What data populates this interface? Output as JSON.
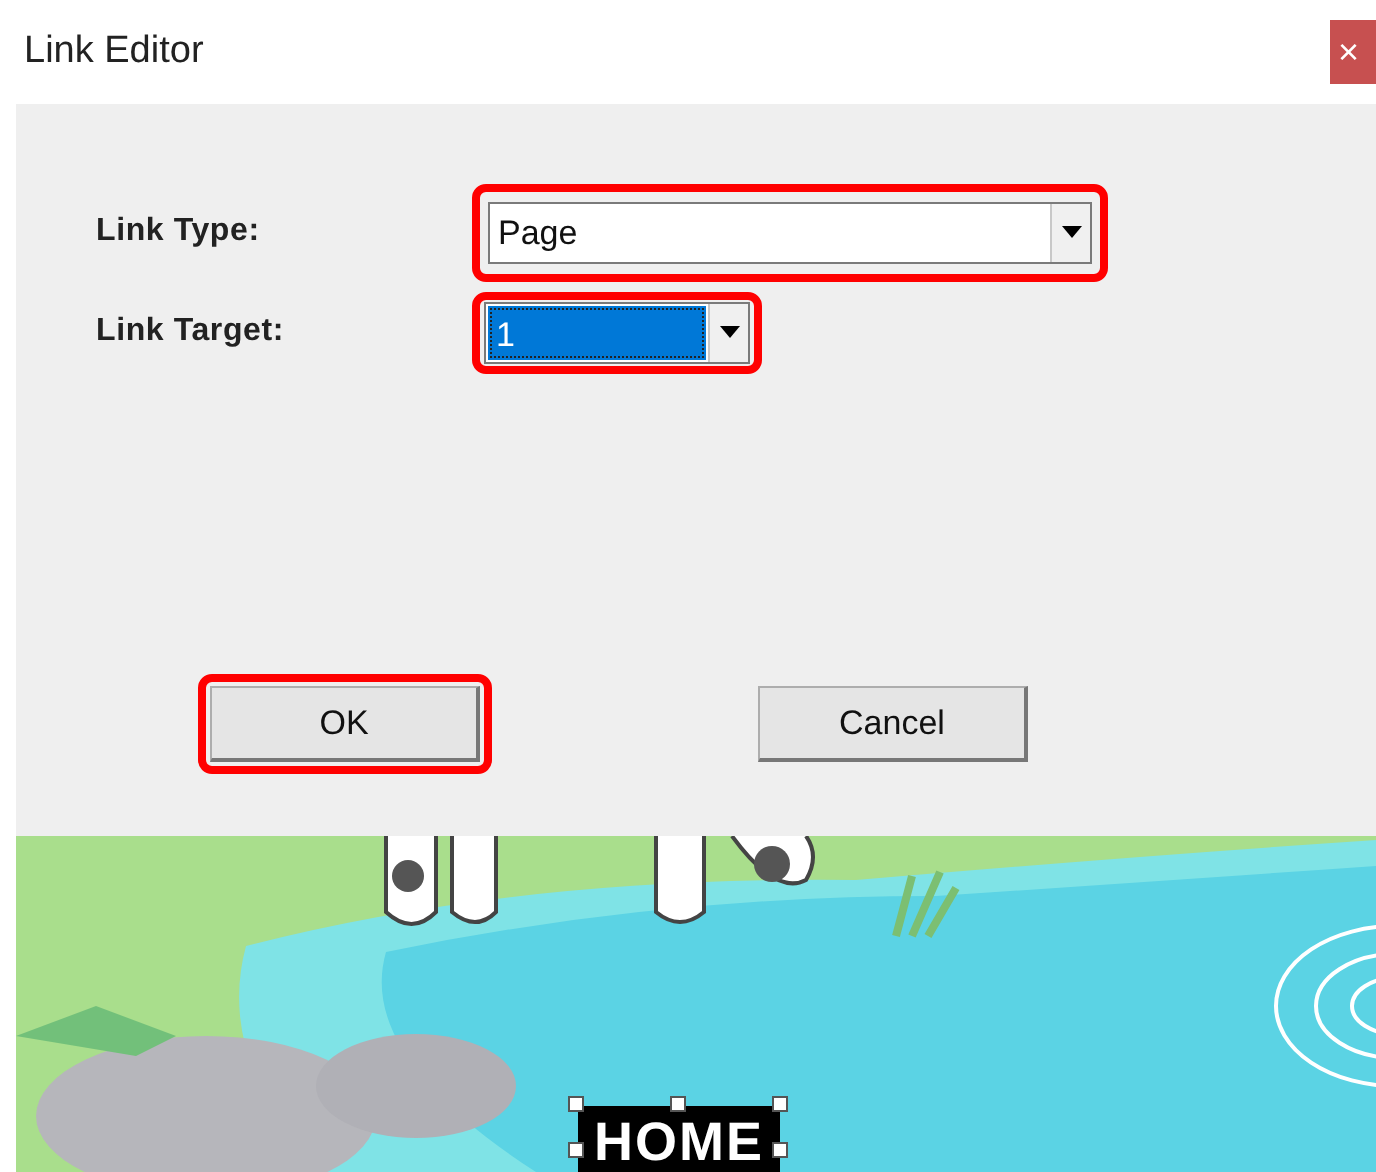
{
  "window": {
    "title": "Link Editor",
    "close_glyph": "×"
  },
  "fields": [
    {
      "label": "Link Type:",
      "value": "Page",
      "kind": "wide",
      "highlighted": true,
      "selected": false
    },
    {
      "label": "Link Target:",
      "value": "1",
      "kind": "narrow",
      "highlighted": true,
      "selected": true
    }
  ],
  "buttons": [
    {
      "label": "OK",
      "highlighted": true
    },
    {
      "label": "Cancel",
      "highlighted": false
    }
  ],
  "canvas_label": {
    "text": "HOME",
    "selected": true
  }
}
